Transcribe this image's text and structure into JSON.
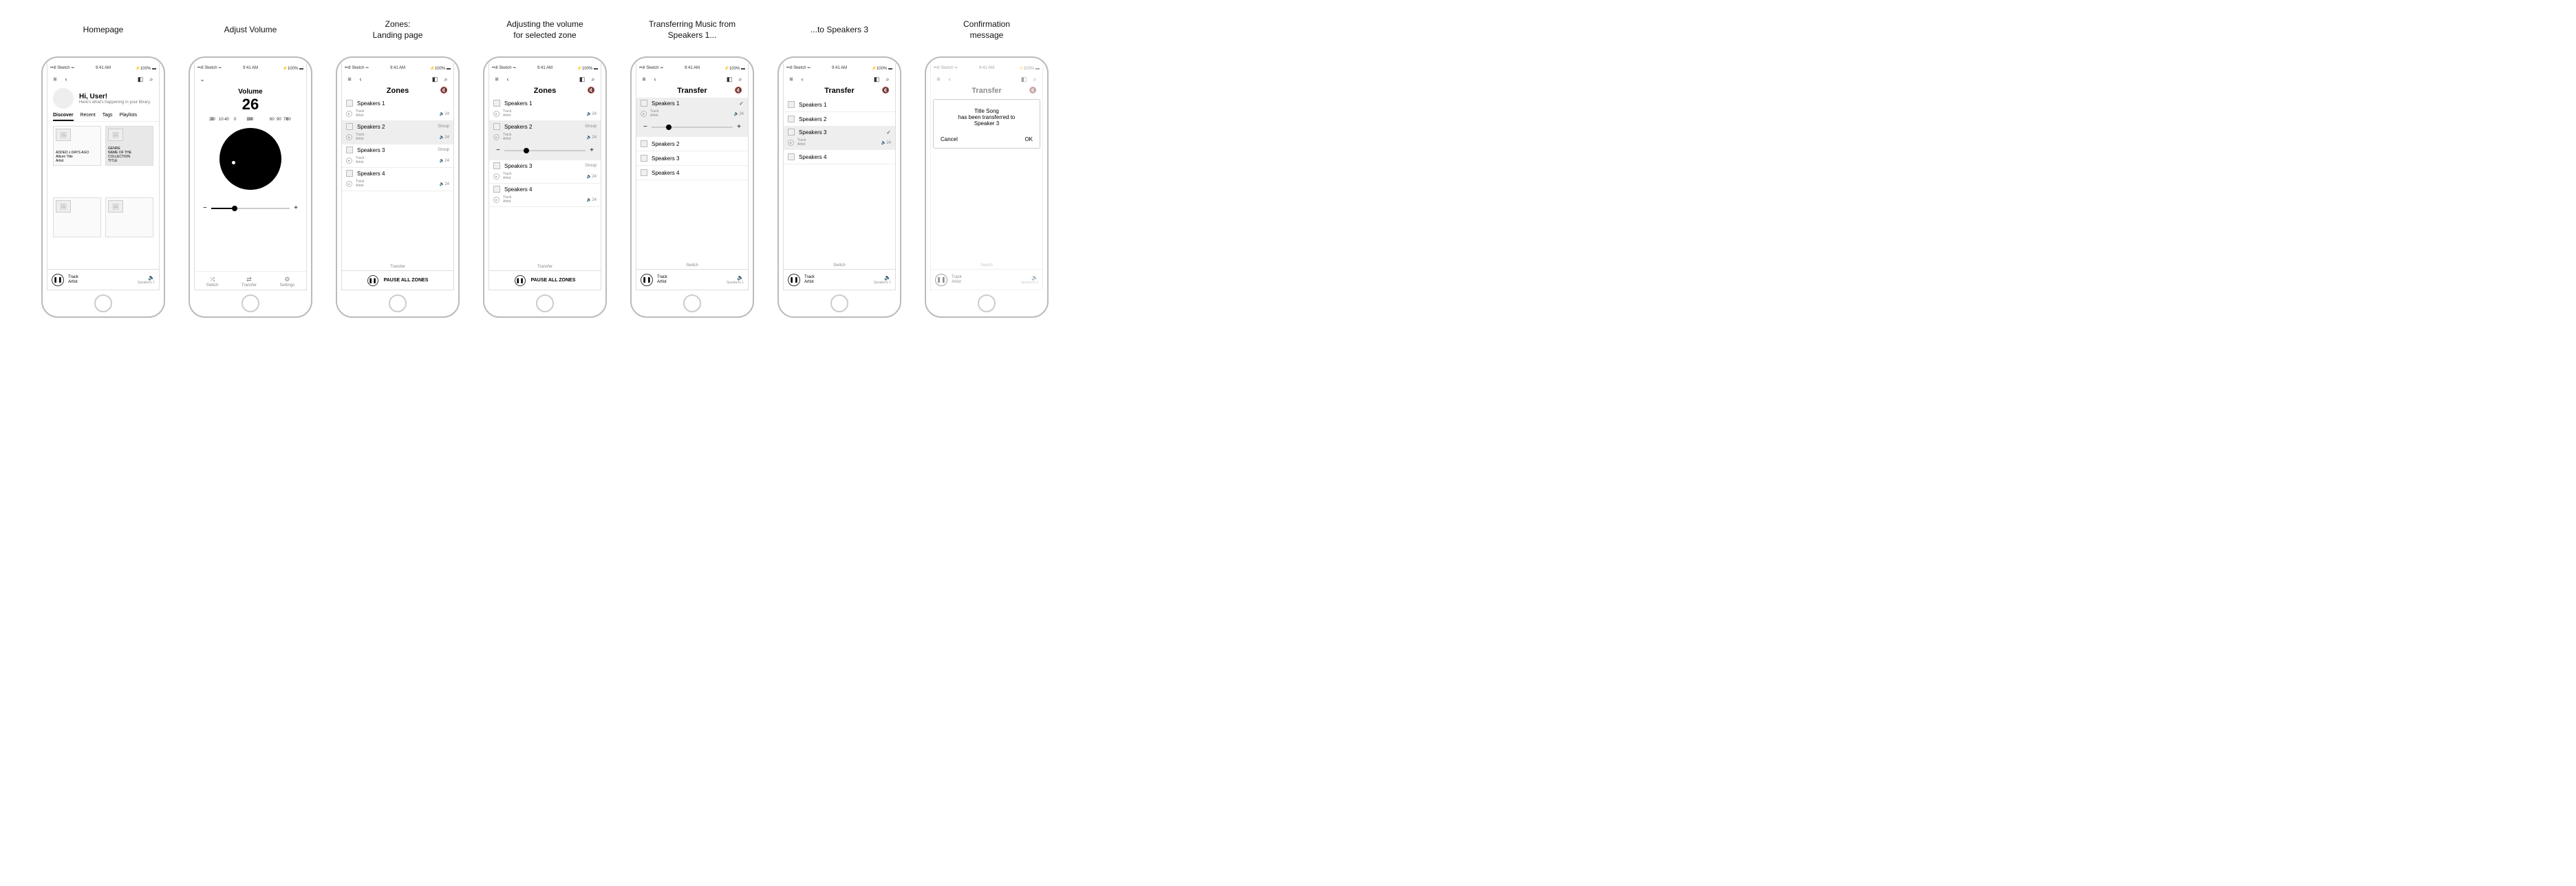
{
  "status": {
    "carrier": "Sketch",
    "time": "9:41 AM",
    "battery": "100%"
  },
  "captions": [
    "Homepage",
    "Adjust Volume",
    "Zones:\nLanding page",
    "Adjusting the volume\nfor selected zone",
    "Transferring Music from\nSpeakers 1...",
    "...to Speakers 3",
    "Confirmation\nmessage"
  ],
  "home": {
    "greeting": "Hi, User!",
    "subtitle": "Here's what's happening in your library.",
    "tabs": [
      "Discover",
      "Recent",
      "Tags",
      "Playlists"
    ],
    "active_tab": 0,
    "card_meta": {
      "added": "ADDED x DAYS AGO",
      "album": "Album Title",
      "artist": "Artist",
      "genre_label": "GENRE",
      "collection_label": "NAME OF THE COLLECTION",
      "title_label": "TITLE"
    }
  },
  "now_playing": {
    "track": "Track",
    "artist": "Artist",
    "speaker": "Speakers 1"
  },
  "volume": {
    "title": "Volume",
    "value": "26",
    "ticks": [
      "0",
      "10",
      "20",
      "30",
      "40",
      "50",
      "60",
      "70",
      "80",
      "90",
      "100"
    ],
    "bottom_tabs": [
      {
        "icon": "⤨",
        "label": "Switch"
      },
      {
        "icon": "⇄",
        "label": "Transfer"
      },
      {
        "icon": "⚙",
        "label": "Settings"
      }
    ]
  },
  "zones": {
    "title": "Zones",
    "items": [
      {
        "name": "Speakers 1",
        "track": "Track",
        "artist": "Artist",
        "vol": "24",
        "group": false
      },
      {
        "name": "Speakers 2",
        "track": "Track",
        "artist": "Artist",
        "vol": "24",
        "group": true
      },
      {
        "name": "Speakers 3",
        "track": "Track",
        "artist": "Artist",
        "vol": "24",
        "group": true
      },
      {
        "name": "Speakers 4",
        "track": "Track",
        "artist": "Artist",
        "vol": "24",
        "group": false
      }
    ],
    "transfer_link": "Transfer",
    "pause_all": "PAUSE ALL ZONES"
  },
  "transfer": {
    "title": "Transfer",
    "items": [
      "Speakers 1",
      "Speakers 2",
      "Speakers 3",
      "Speakers 4"
    ],
    "switch_link": "Switch"
  },
  "transfer_sub": {
    "track": "Track",
    "artist": "Artist",
    "vol": "24"
  },
  "confirm": {
    "line1": "Title Song",
    "line2": "has been transferred to",
    "line3": "Speaker 3",
    "cancel": "Cancel",
    "ok": "OK"
  }
}
